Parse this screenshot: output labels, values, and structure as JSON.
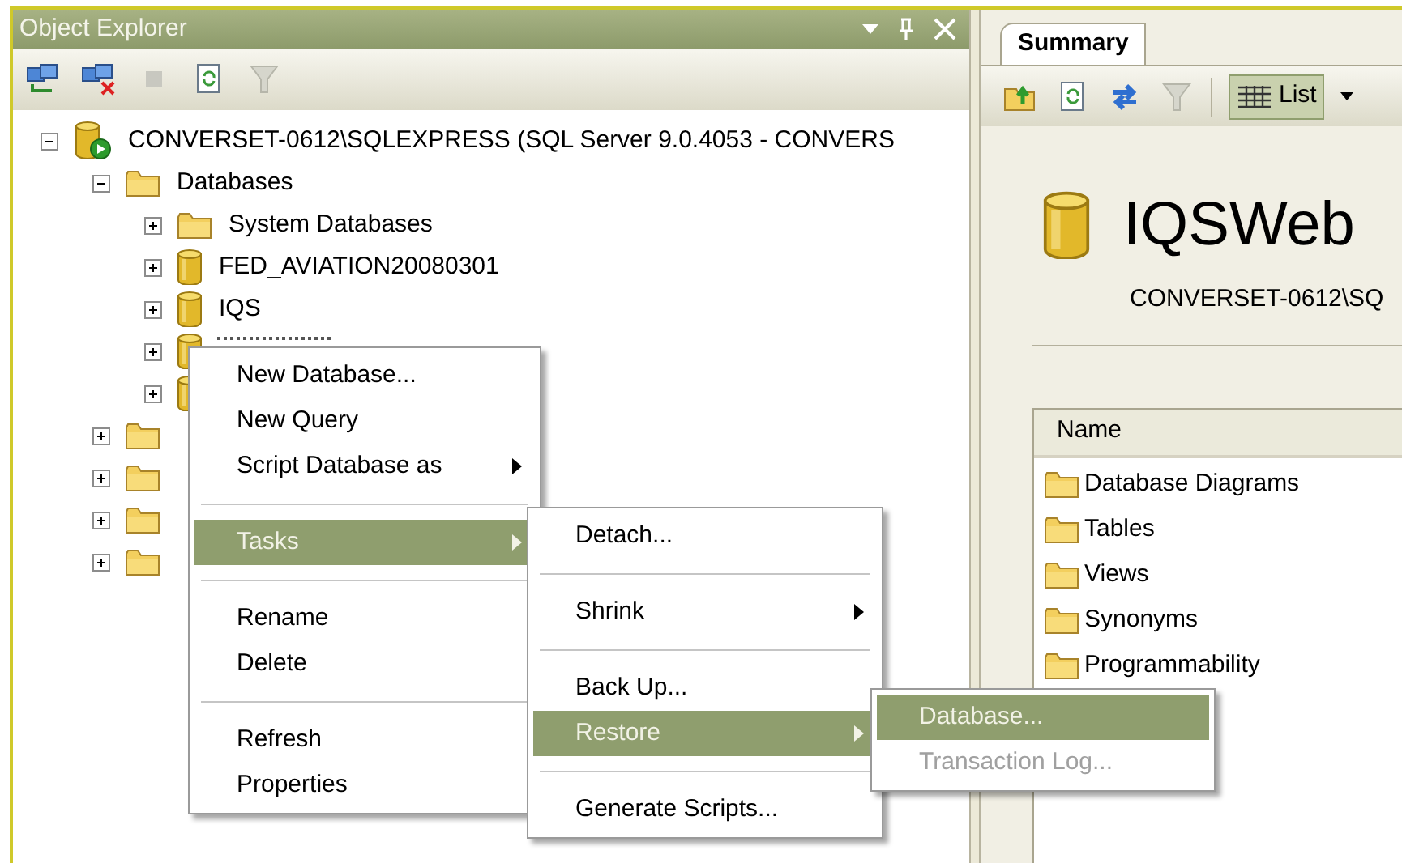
{
  "object_explorer": {
    "title": "Object Explorer",
    "tree": [
      {
        "kind": "server",
        "label": "CONVERSET-0612\\SQLEXPRESS (SQL Server 9.0.4053 - CONVERS",
        "expanded": true,
        "selected": false,
        "children": [
          {
            "kind": "folder",
            "label": "Databases",
            "expanded": true,
            "selected": false,
            "children": [
              {
                "kind": "folder",
                "label": "System Databases",
                "expanded": false,
                "selected": false
              },
              {
                "kind": "database",
                "label": "FED_AVIATION20080301",
                "expanded": false,
                "selected": false
              },
              {
                "kind": "database",
                "label": "IQS",
                "expanded": false,
                "selected": false
              },
              {
                "kind": "database",
                "expanded": false,
                "selected": true
              },
              {
                "kind": "database",
                "expanded": false,
                "selected": false
              }
            ]
          },
          {
            "kind": "folder",
            "expanded": false,
            "selected": false
          },
          {
            "kind": "folder",
            "expanded": false,
            "selected": false
          },
          {
            "kind": "folder",
            "expanded": false,
            "selected": false
          },
          {
            "kind": "folder",
            "expanded": false,
            "selected": false
          }
        ]
      }
    ]
  },
  "summary": {
    "tab": {
      "label": "Summary",
      "selected": true
    },
    "view_button": "List",
    "title": "IQSWeb",
    "subtitle": "CONVERSET-0612\\SQ",
    "column": "Name",
    "items": [
      "Database Diagrams",
      "Tables",
      "Views",
      "Synonyms",
      "Programmability"
    ]
  },
  "context_menu": [
    {
      "kind": "item",
      "label": "New Database...",
      "submenu": false,
      "selected": false
    },
    {
      "kind": "item",
      "label": "New Query",
      "submenu": false,
      "selected": false
    },
    {
      "kind": "item",
      "label": "Script Database as",
      "submenu": true,
      "selected": false
    },
    {
      "kind": "separator"
    },
    {
      "kind": "item",
      "label": "Tasks",
      "submenu": true,
      "selected": true
    },
    {
      "kind": "separator"
    },
    {
      "kind": "item",
      "label": "Rename",
      "submenu": false,
      "selected": false
    },
    {
      "kind": "item",
      "label": "Delete",
      "submenu": false,
      "selected": false
    },
    {
      "kind": "separator"
    },
    {
      "kind": "item",
      "label": "Refresh",
      "submenu": false,
      "selected": false
    },
    {
      "kind": "item",
      "label": "Properties",
      "submenu": false,
      "selected": false
    }
  ],
  "tasks_menu": [
    {
      "kind": "item",
      "label": "Detach...",
      "submenu": false,
      "selected": false
    },
    {
      "kind": "separator"
    },
    {
      "kind": "item",
      "label": "Shrink",
      "submenu": true,
      "selected": false
    },
    {
      "kind": "separator"
    },
    {
      "kind": "item",
      "label": "Back Up...",
      "submenu": false,
      "selected": false
    },
    {
      "kind": "item",
      "label": "Restore",
      "submenu": true,
      "selected": true
    },
    {
      "kind": "separator"
    },
    {
      "kind": "item",
      "label": "Generate Scripts...",
      "submenu": false,
      "selected": false
    }
  ],
  "restore_menu": [
    {
      "kind": "item",
      "label": "Database...",
      "submenu": false,
      "selected": true,
      "disabled": false
    },
    {
      "kind": "item",
      "label": "Transaction Log...",
      "submenu": false,
      "selected": false,
      "disabled": true
    }
  ]
}
